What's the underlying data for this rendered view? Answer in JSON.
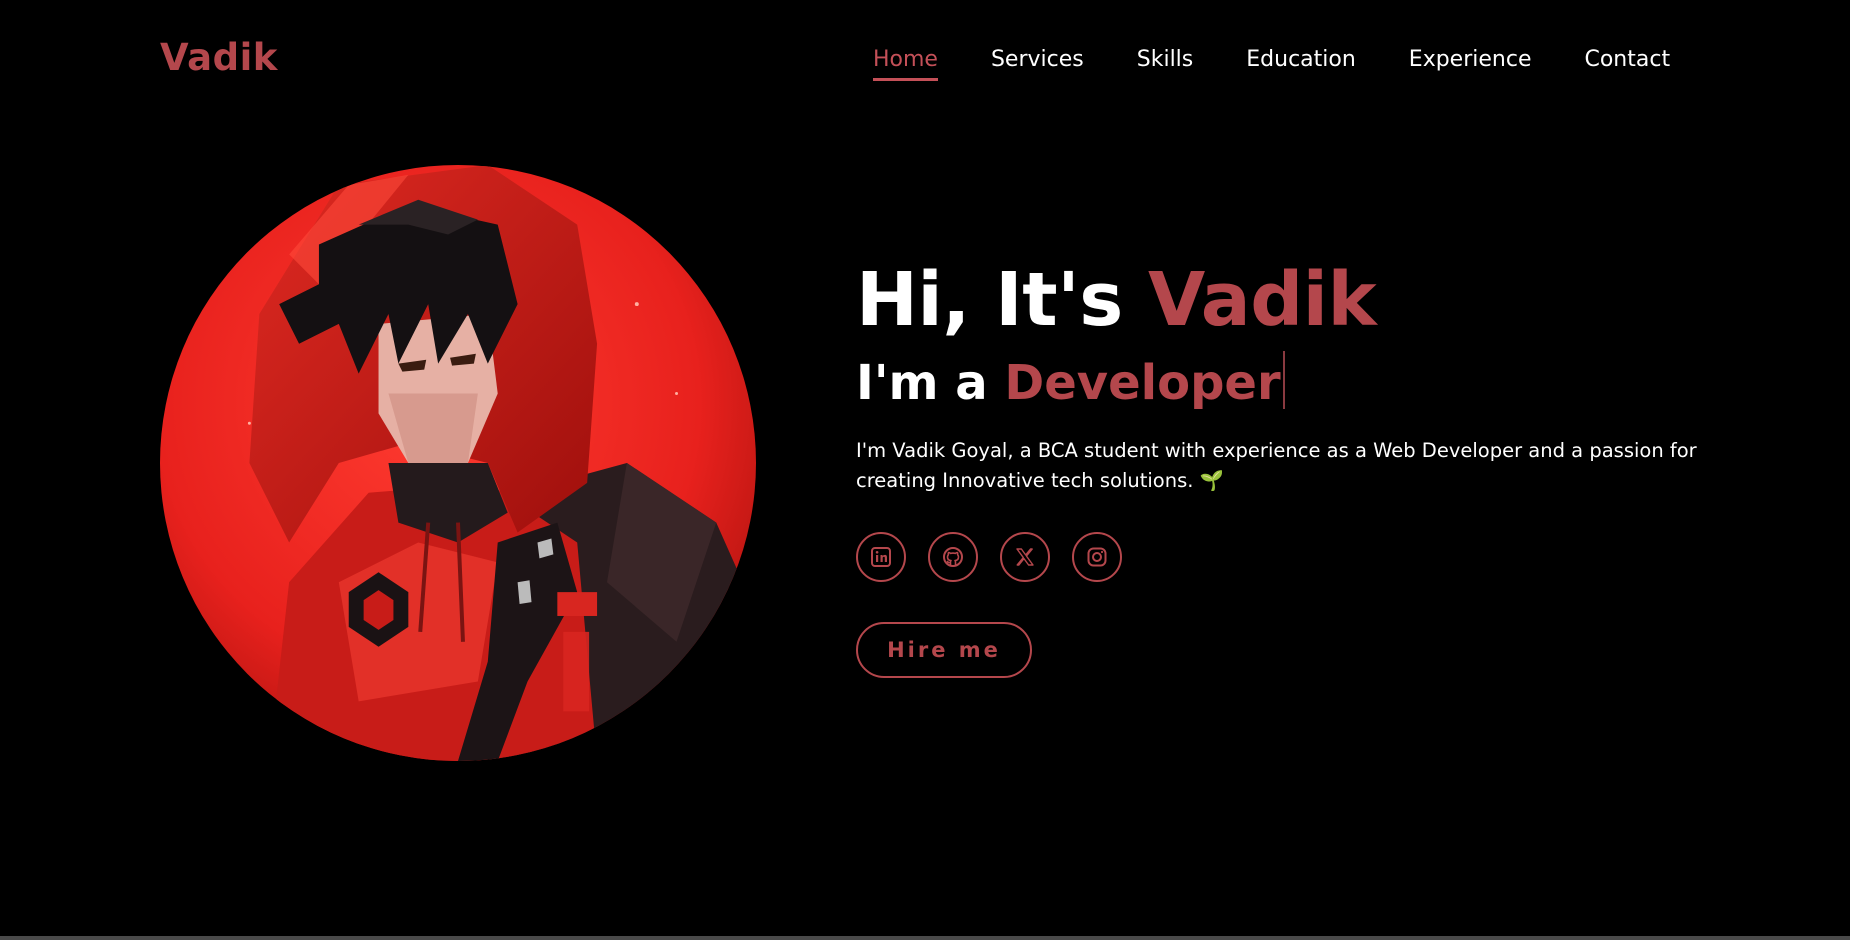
{
  "header": {
    "logo": "Vadik",
    "nav": [
      {
        "label": "Home",
        "active": true
      },
      {
        "label": "Services"
      },
      {
        "label": "Skills"
      },
      {
        "label": "Education"
      },
      {
        "label": "Experience"
      },
      {
        "label": "Contact"
      }
    ]
  },
  "hero": {
    "greeting_prefix": "Hi, It's ",
    "greeting_name": "Vadik",
    "role_prefix": "I'm a ",
    "role_word": "Developer",
    "bio": "I'm Vadik Goyal, a BCA student with experience as a Web Developer and a passion for creating Innovative tech solutions. 🌱",
    "socials": [
      "linkedin-icon",
      "github-icon",
      "x-icon",
      "instagram-icon"
    ],
    "hire_label": "Hire me"
  },
  "colors": {
    "accent": "#b4474c",
    "background": "#000000",
    "text": "#ffffff"
  }
}
